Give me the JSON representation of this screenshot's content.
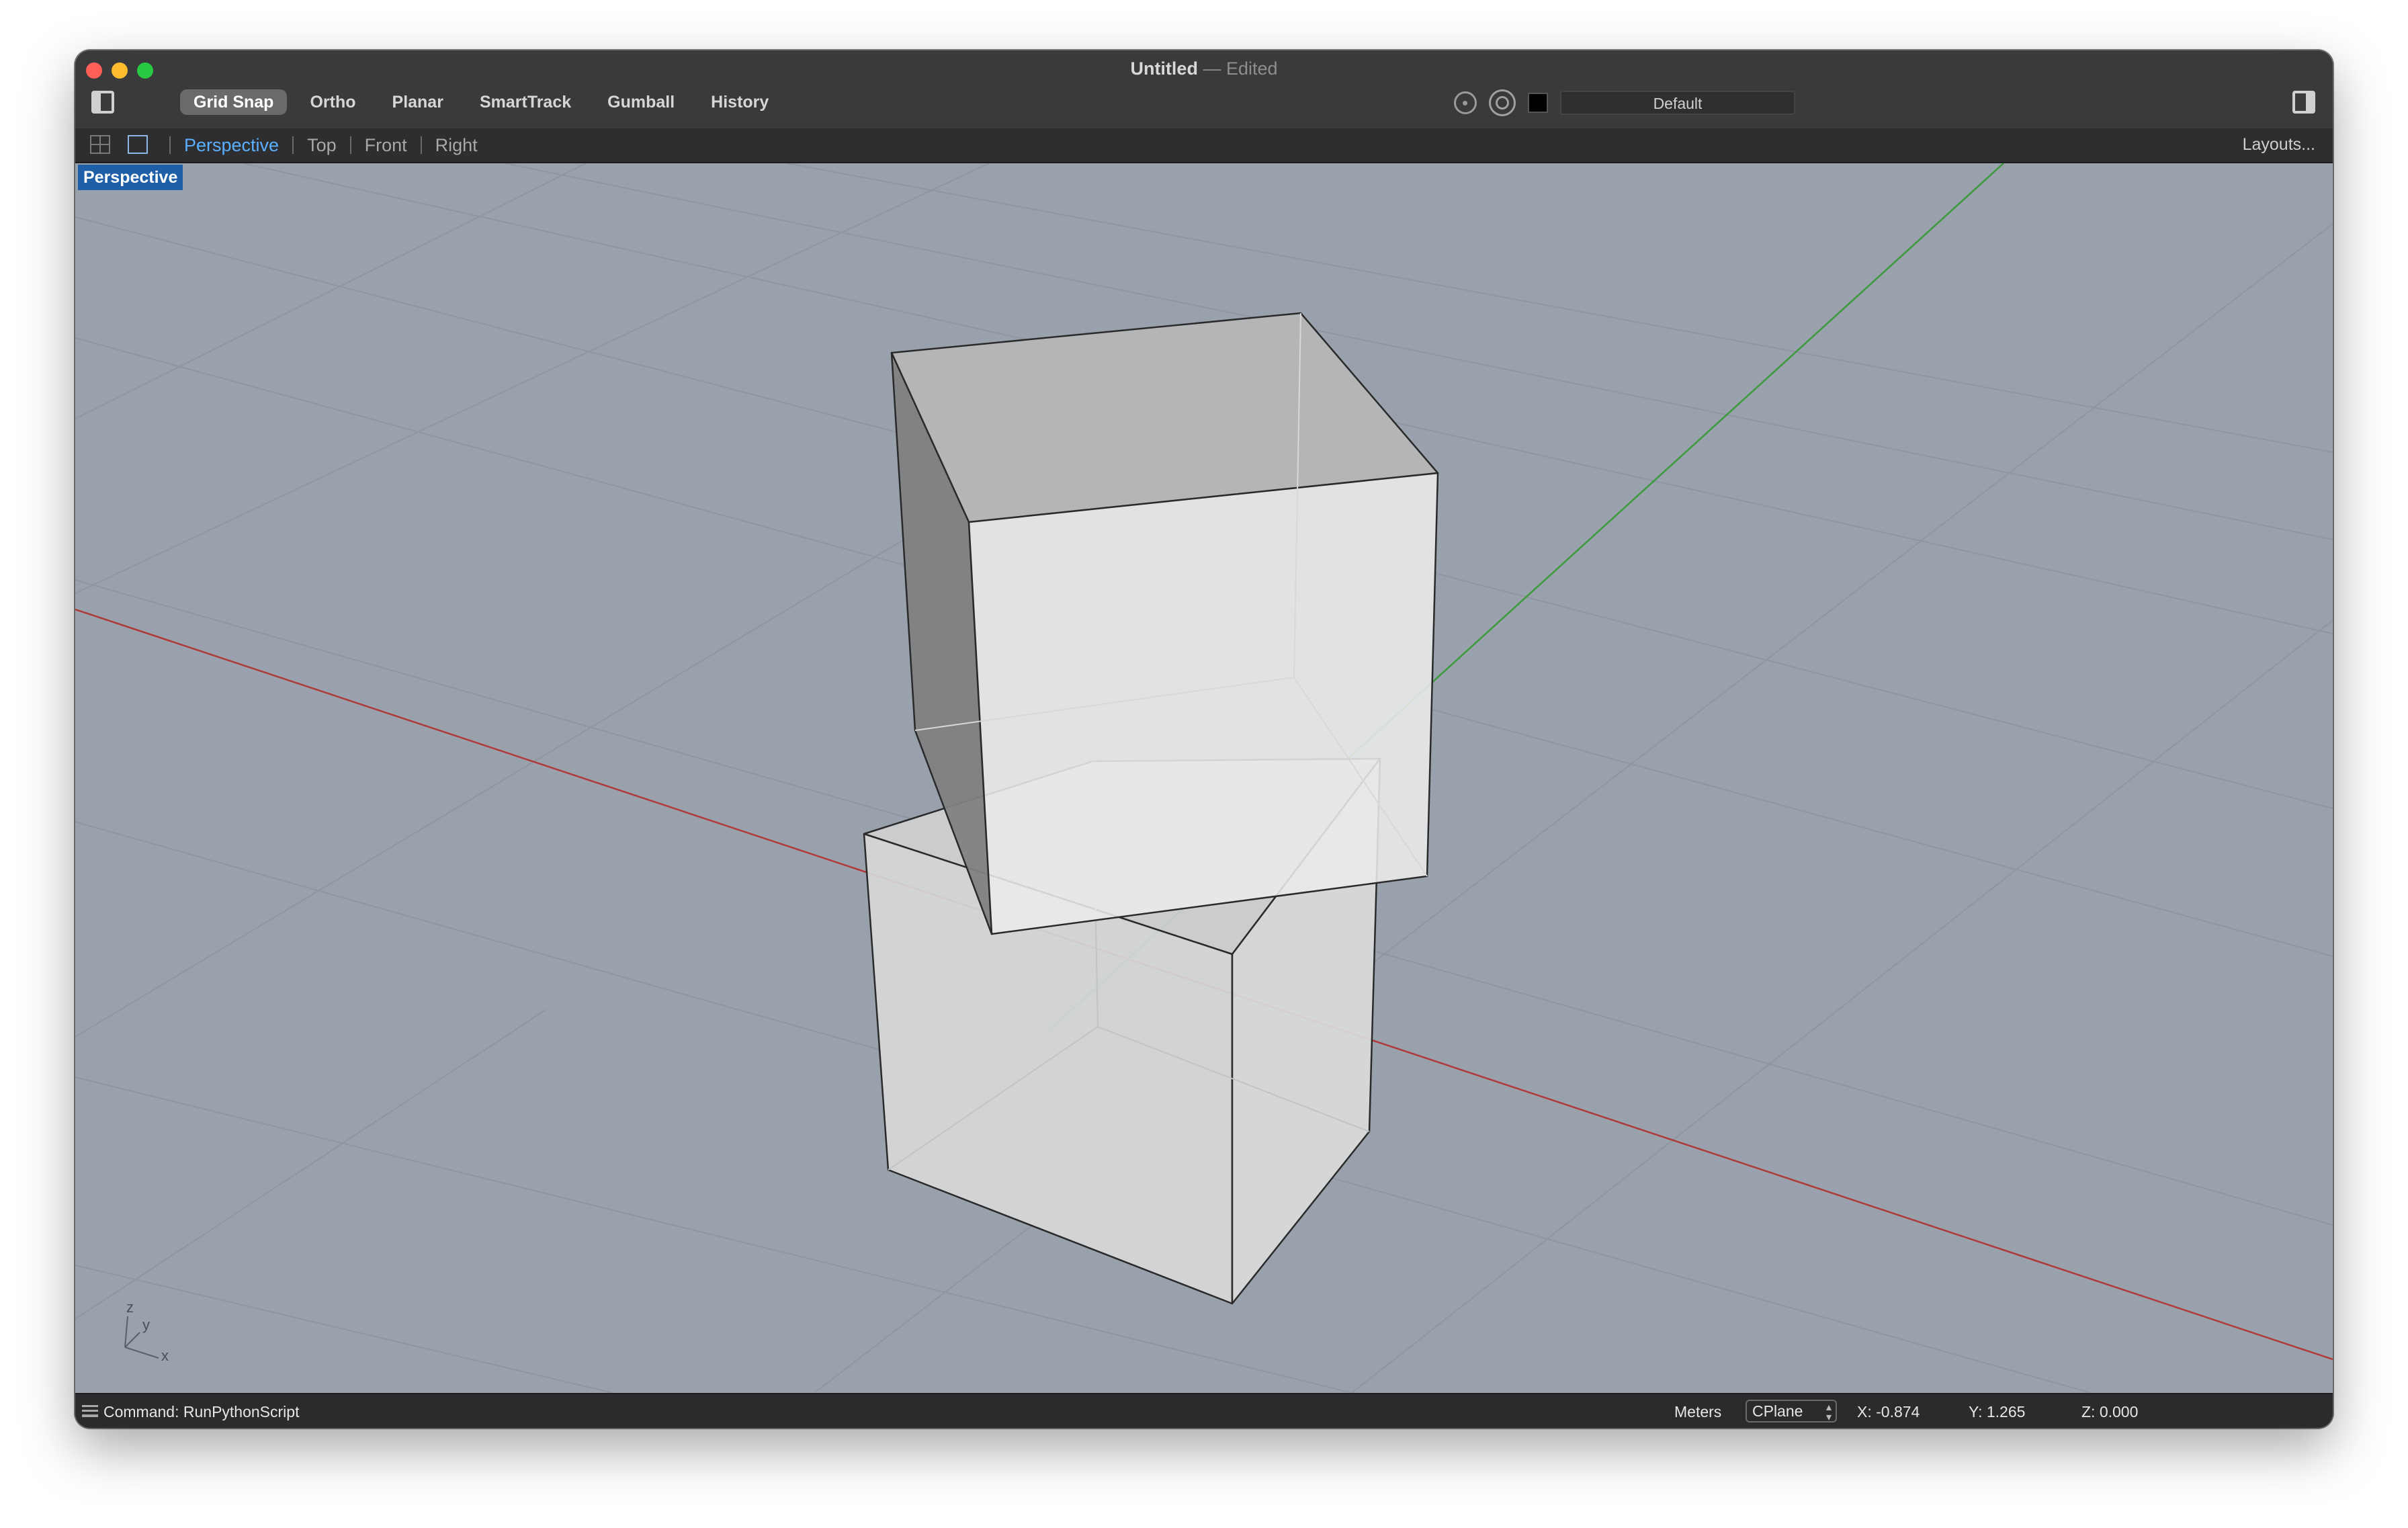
{
  "window": {
    "title": "Untitled",
    "title_sep": "—",
    "title_status": "Edited"
  },
  "toolbar": {
    "toggles": [
      {
        "label": "Grid Snap",
        "active": true
      },
      {
        "label": "Ortho",
        "active": false
      },
      {
        "label": "Planar",
        "active": false
      },
      {
        "label": "SmartTrack",
        "active": false
      },
      {
        "label": "Gumball",
        "active": false
      },
      {
        "label": "History",
        "active": false
      }
    ],
    "layer": {
      "name": "Default",
      "color": "#000000"
    }
  },
  "viewport_tabs": {
    "tabs": [
      "Perspective",
      "Top",
      "Front",
      "Right"
    ],
    "active": "Perspective",
    "layouts_label": "Layouts..."
  },
  "viewport": {
    "label": "Perspective",
    "background": "#99a1ac",
    "axis_labels": {
      "z": "z",
      "y": "y",
      "x": "x"
    },
    "x_axis_color": "#b03a3a",
    "y_axis_color": "#3c9a3c"
  },
  "statusbar": {
    "command": "Command: RunPythonScript",
    "units": "Meters",
    "cplane": "CPlane",
    "x": "X: -0.874",
    "y": "Y: 1.265",
    "z": "Z: 0.000"
  }
}
